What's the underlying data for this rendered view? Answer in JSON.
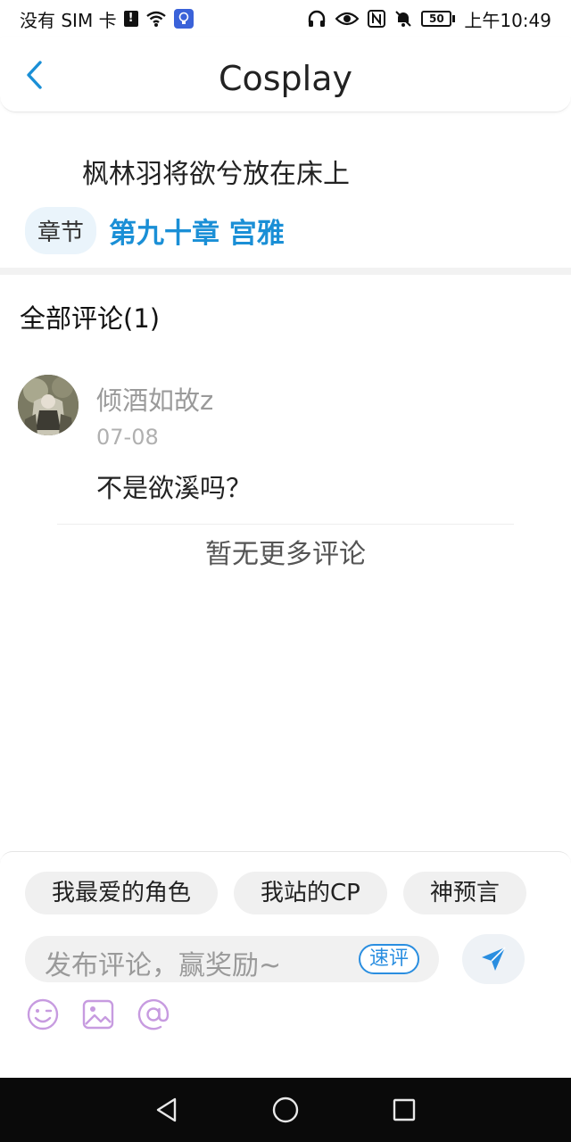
{
  "status_bar": {
    "sim_text": "没有 SIM 卡",
    "battery": "50",
    "time": "上午10:49"
  },
  "header": {
    "title": "Cosplay"
  },
  "topic": {
    "text": "枫林羽将欲兮放在床上",
    "chapter_label": "章节",
    "chapter_name": "第九十章 宫雅"
  },
  "comments": {
    "heading": "全部评论(1)",
    "items": [
      {
        "user": "倾酒如故z",
        "date": "07-08",
        "text": "不是欲溪吗？"
      }
    ],
    "no_more": "暂无更多评论"
  },
  "composer": {
    "chips": [
      "我最爱的角色",
      "我站的CP",
      "神预言"
    ],
    "placeholder": "发布评论，赢奖励~",
    "quick_label": "速评",
    "accent": "#2a8ee0",
    "icon_color": "#c79be0"
  }
}
